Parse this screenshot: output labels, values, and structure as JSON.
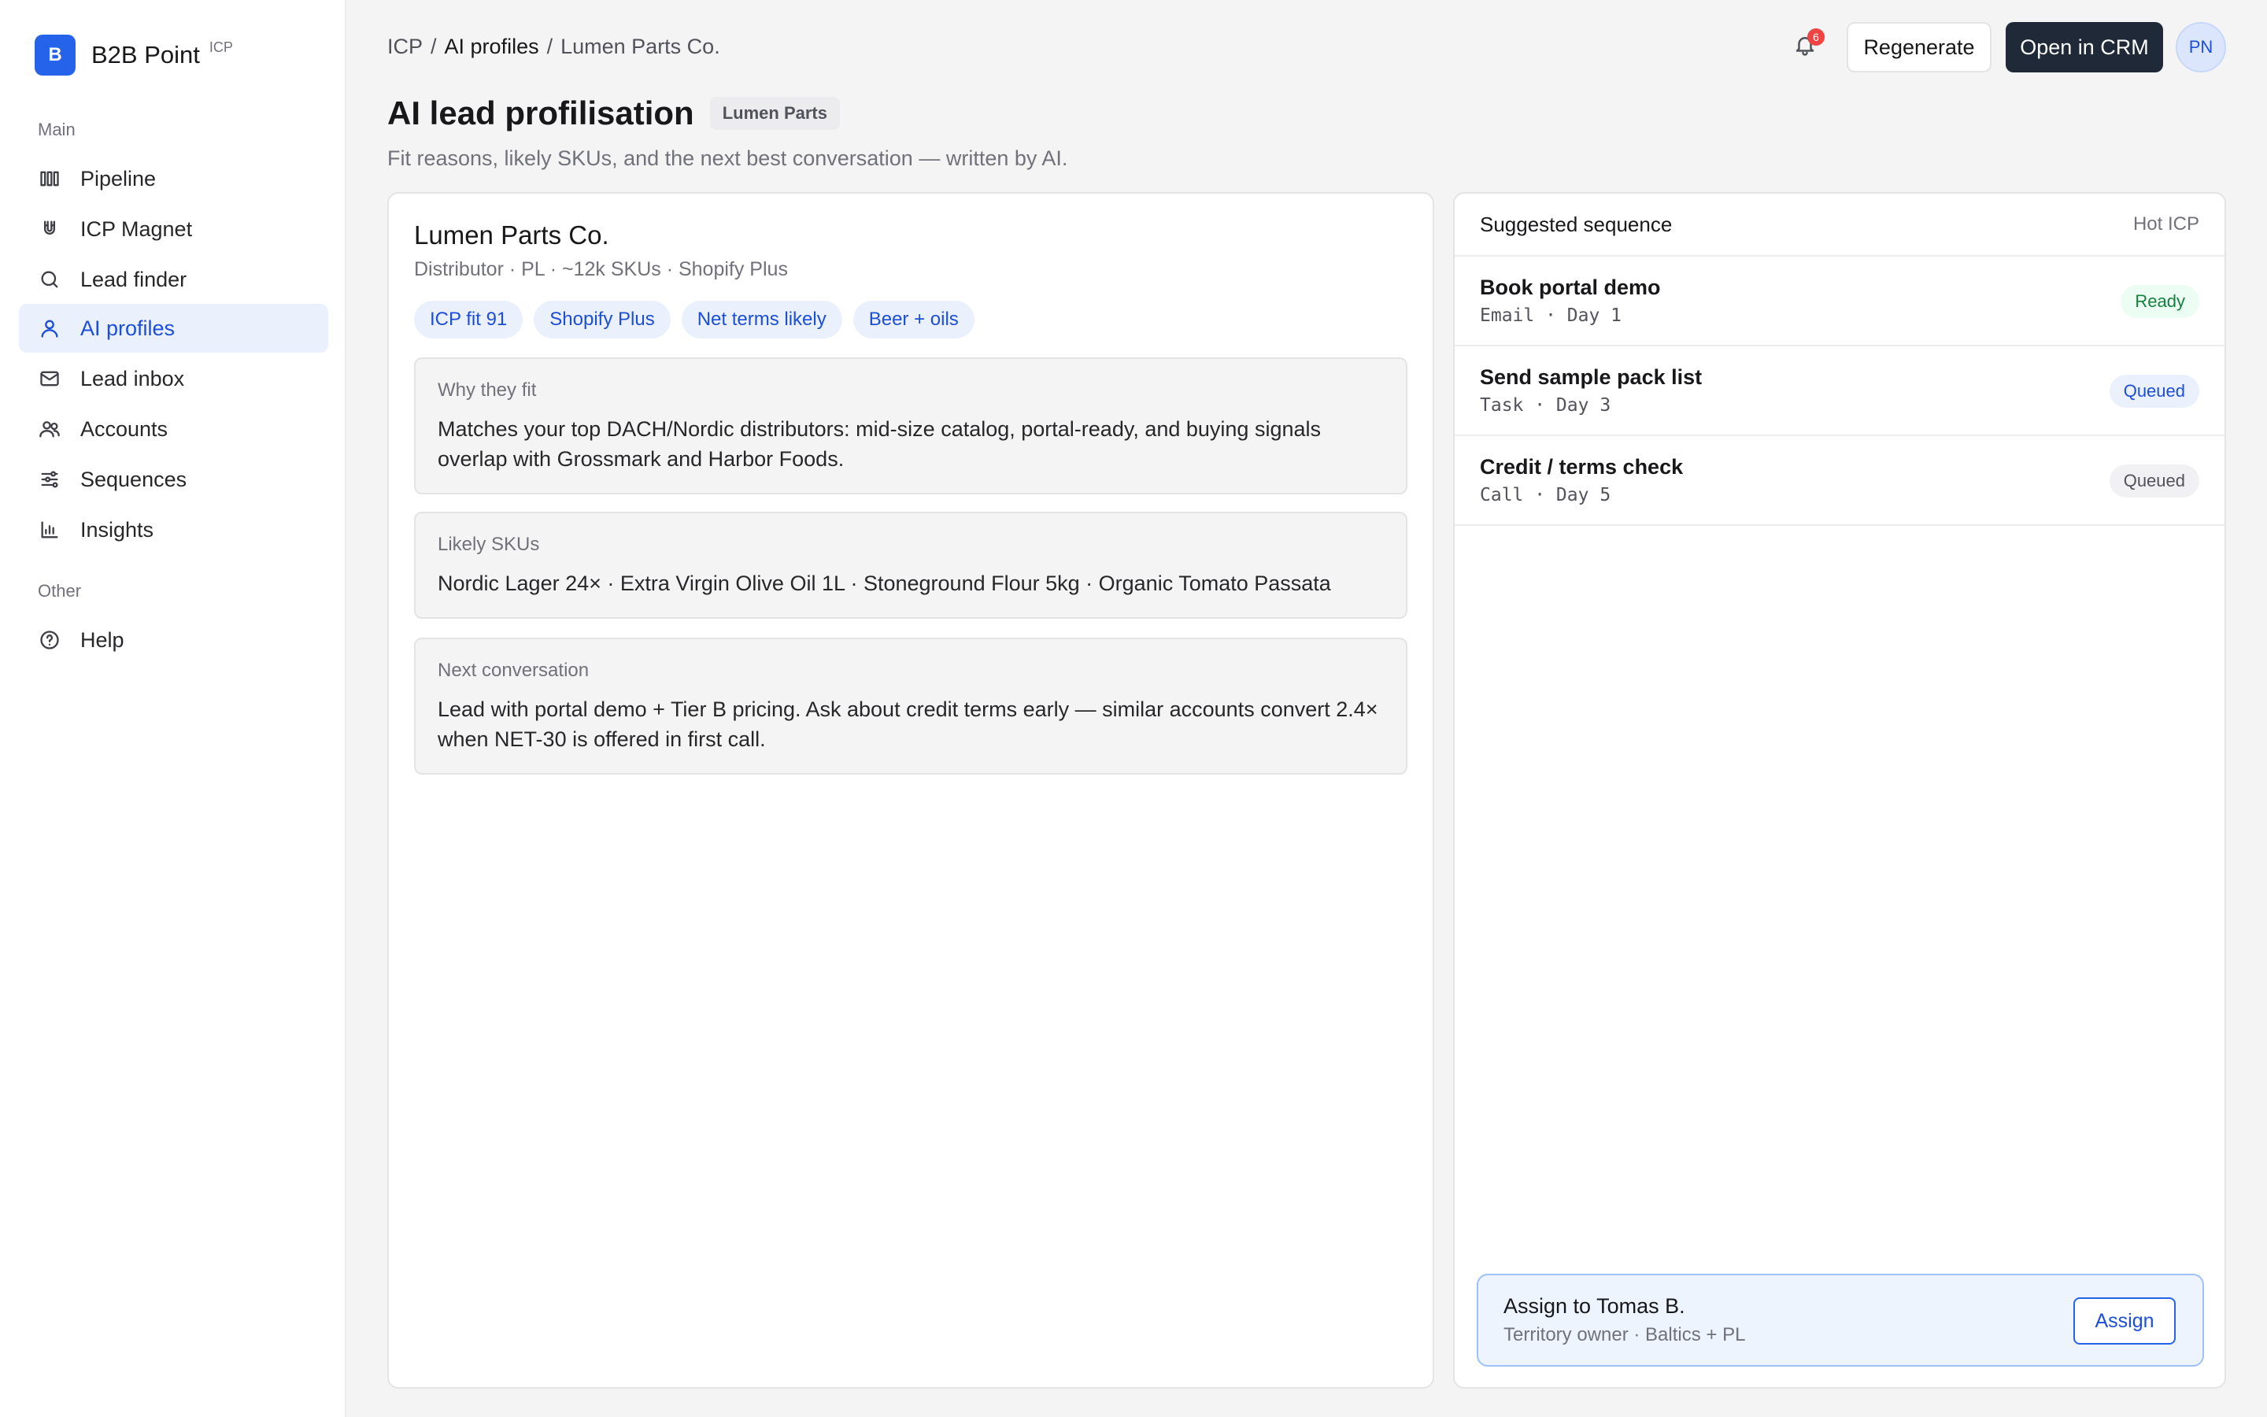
{
  "brand": {
    "logo_letter": "B",
    "name": "B2B Point",
    "tag": "ICP"
  },
  "sidebar": {
    "main_label": "Main",
    "other_label": "Other",
    "items": [
      {
        "label": "Pipeline",
        "icon": "pipeline-icon"
      },
      {
        "label": "ICP Magnet",
        "icon": "magnet-icon"
      },
      {
        "label": "Lead finder",
        "icon": "search-icon"
      },
      {
        "label": "AI profiles",
        "icon": "user-icon",
        "active": true
      },
      {
        "label": "Lead inbox",
        "icon": "mail-icon"
      },
      {
        "label": "Accounts",
        "icon": "users-icon"
      },
      {
        "label": "Sequences",
        "icon": "sliders-icon"
      },
      {
        "label": "Insights",
        "icon": "bar-chart-icon"
      }
    ],
    "other_items": [
      {
        "label": "Help",
        "icon": "help-circle-icon"
      }
    ]
  },
  "header": {
    "breadcrumb": [
      "ICP",
      "AI profiles",
      "Lumen Parts Co."
    ],
    "notifications_count": "6",
    "regenerate_label": "Regenerate",
    "open_crm_label": "Open in CRM",
    "avatar_initials": "PN"
  },
  "page": {
    "title": "AI lead profilisation",
    "title_chip": "Lumen Parts",
    "subtitle": "Fit reasons, likely SKUs, and the next best conversation — written by AI."
  },
  "profile": {
    "company_name": "Lumen Parts Co.",
    "meta": "Distributor · PL · ~12k SKUs · Shopify Plus",
    "tags": [
      "ICP fit 91",
      "Shopify Plus",
      "Net terms likely",
      "Beer + oils"
    ],
    "why_fit": {
      "label": "Why they fit",
      "text": "Matches your top DACH/Nordic distributors: mid-size catalog, portal-ready, and buying signals overlap with Grossmark and Harbor Foods."
    },
    "likely_skus": {
      "label": "Likely SKUs",
      "text": "Nordic Lager 24× · Extra Virgin Olive Oil 1L · Stoneground Flour 5kg · Organic Tomato Passata"
    },
    "next_conversation": {
      "label": "Next conversation",
      "text": "Lead with portal demo + Tier B pricing. Ask about credit terms early — similar accounts convert 2.4× when NET-30 is offered in first call."
    }
  },
  "sequence": {
    "title": "Suggested sequence",
    "badge": "Hot ICP",
    "steps": [
      {
        "name": "Book portal demo",
        "detail": "Email · Day 1",
        "status": "Ready"
      },
      {
        "name": "Send sample pack list",
        "detail": "Task · Day 3",
        "status": "Queued"
      },
      {
        "name": "Credit / terms check",
        "detail": "Call · Day 5",
        "status": "Queued"
      }
    ]
  },
  "assign": {
    "title": "Assign to Tomas B.",
    "subtitle": "Territory owner · Baltics + PL",
    "button_label": "Assign"
  },
  "colors": {
    "accent": "#2563eb",
    "dark_button": "#1f2937",
    "ready_green": "#15803d",
    "badge_red": "#ef4444"
  }
}
